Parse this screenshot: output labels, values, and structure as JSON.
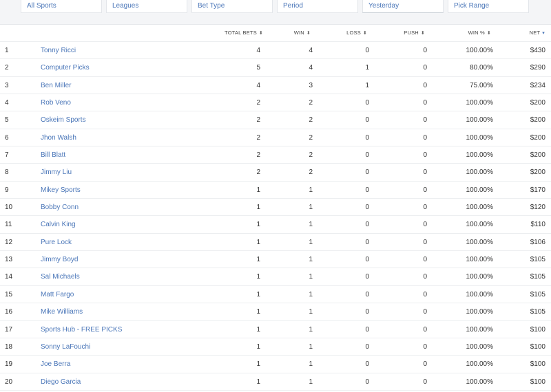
{
  "filters": {
    "sport": "All Sports",
    "league": "Leagues",
    "bet_type": "Bet Type",
    "period": "Period",
    "date": "Yesterday",
    "pick_range": "Pick Range"
  },
  "table": {
    "columns": {
      "total_bets": "TOTAL BETS",
      "win": "WIN",
      "loss": "LOSS",
      "push": "PUSH",
      "win_pct": "WIN %",
      "net": "NET"
    },
    "sort_glyph": "⬍",
    "sort_active_glyph": "▾",
    "rows": [
      {
        "rank": "1",
        "name": "Tonny Ricci",
        "total": "4",
        "win": "4",
        "loss": "0",
        "push": "0",
        "pct": "100.00%",
        "net": "$430"
      },
      {
        "rank": "2",
        "name": "Computer Picks",
        "total": "5",
        "win": "4",
        "loss": "1",
        "push": "0",
        "pct": "80.00%",
        "net": "$290"
      },
      {
        "rank": "3",
        "name": "Ben Miller",
        "total": "4",
        "win": "3",
        "loss": "1",
        "push": "0",
        "pct": "75.00%",
        "net": "$234"
      },
      {
        "rank": "4",
        "name": "Rob Veno",
        "total": "2",
        "win": "2",
        "loss": "0",
        "push": "0",
        "pct": "100.00%",
        "net": "$200"
      },
      {
        "rank": "5",
        "name": "Oskeim Sports",
        "total": "2",
        "win": "2",
        "loss": "0",
        "push": "0",
        "pct": "100.00%",
        "net": "$200"
      },
      {
        "rank": "6",
        "name": "Jhon Walsh",
        "total": "2",
        "win": "2",
        "loss": "0",
        "push": "0",
        "pct": "100.00%",
        "net": "$200"
      },
      {
        "rank": "7",
        "name": "Bill Blatt",
        "total": "2",
        "win": "2",
        "loss": "0",
        "push": "0",
        "pct": "100.00%",
        "net": "$200"
      },
      {
        "rank": "8",
        "name": "Jimmy Liu",
        "total": "2",
        "win": "2",
        "loss": "0",
        "push": "0",
        "pct": "100.00%",
        "net": "$200"
      },
      {
        "rank": "9",
        "name": "Mikey Sports",
        "total": "1",
        "win": "1",
        "loss": "0",
        "push": "0",
        "pct": "100.00%",
        "net": "$170"
      },
      {
        "rank": "10",
        "name": "Bobby Conn",
        "total": "1",
        "win": "1",
        "loss": "0",
        "push": "0",
        "pct": "100.00%",
        "net": "$120"
      },
      {
        "rank": "11",
        "name": "Calvin King",
        "total": "1",
        "win": "1",
        "loss": "0",
        "push": "0",
        "pct": "100.00%",
        "net": "$110"
      },
      {
        "rank": "12",
        "name": "Pure Lock",
        "total": "1",
        "win": "1",
        "loss": "0",
        "push": "0",
        "pct": "100.00%",
        "net": "$106"
      },
      {
        "rank": "13",
        "name": "Jimmy Boyd",
        "total": "1",
        "win": "1",
        "loss": "0",
        "push": "0",
        "pct": "100.00%",
        "net": "$105"
      },
      {
        "rank": "14",
        "name": "Sal Michaels",
        "total": "1",
        "win": "1",
        "loss": "0",
        "push": "0",
        "pct": "100.00%",
        "net": "$105"
      },
      {
        "rank": "15",
        "name": "Matt Fargo",
        "total": "1",
        "win": "1",
        "loss": "0",
        "push": "0",
        "pct": "100.00%",
        "net": "$105"
      },
      {
        "rank": "16",
        "name": "Mike Williams",
        "total": "1",
        "win": "1",
        "loss": "0",
        "push": "0",
        "pct": "100.00%",
        "net": "$105"
      },
      {
        "rank": "17",
        "name": "Sports Hub - FREE PICKS",
        "total": "1",
        "win": "1",
        "loss": "0",
        "push": "0",
        "pct": "100.00%",
        "net": "$100"
      },
      {
        "rank": "18",
        "name": "Sonny LaFouchi",
        "total": "1",
        "win": "1",
        "loss": "0",
        "push": "0",
        "pct": "100.00%",
        "net": "$100"
      },
      {
        "rank": "19",
        "name": "Joe Berra",
        "total": "1",
        "win": "1",
        "loss": "0",
        "push": "0",
        "pct": "100.00%",
        "net": "$100"
      },
      {
        "rank": "20",
        "name": "Diego Garcia",
        "total": "1",
        "win": "1",
        "loss": "0",
        "push": "0",
        "pct": "100.00%",
        "net": "$100"
      }
    ]
  },
  "colors": {
    "link": "#4a76b8",
    "row_border": "#eceef0",
    "filter_bg": "#f4f5f7"
  }
}
